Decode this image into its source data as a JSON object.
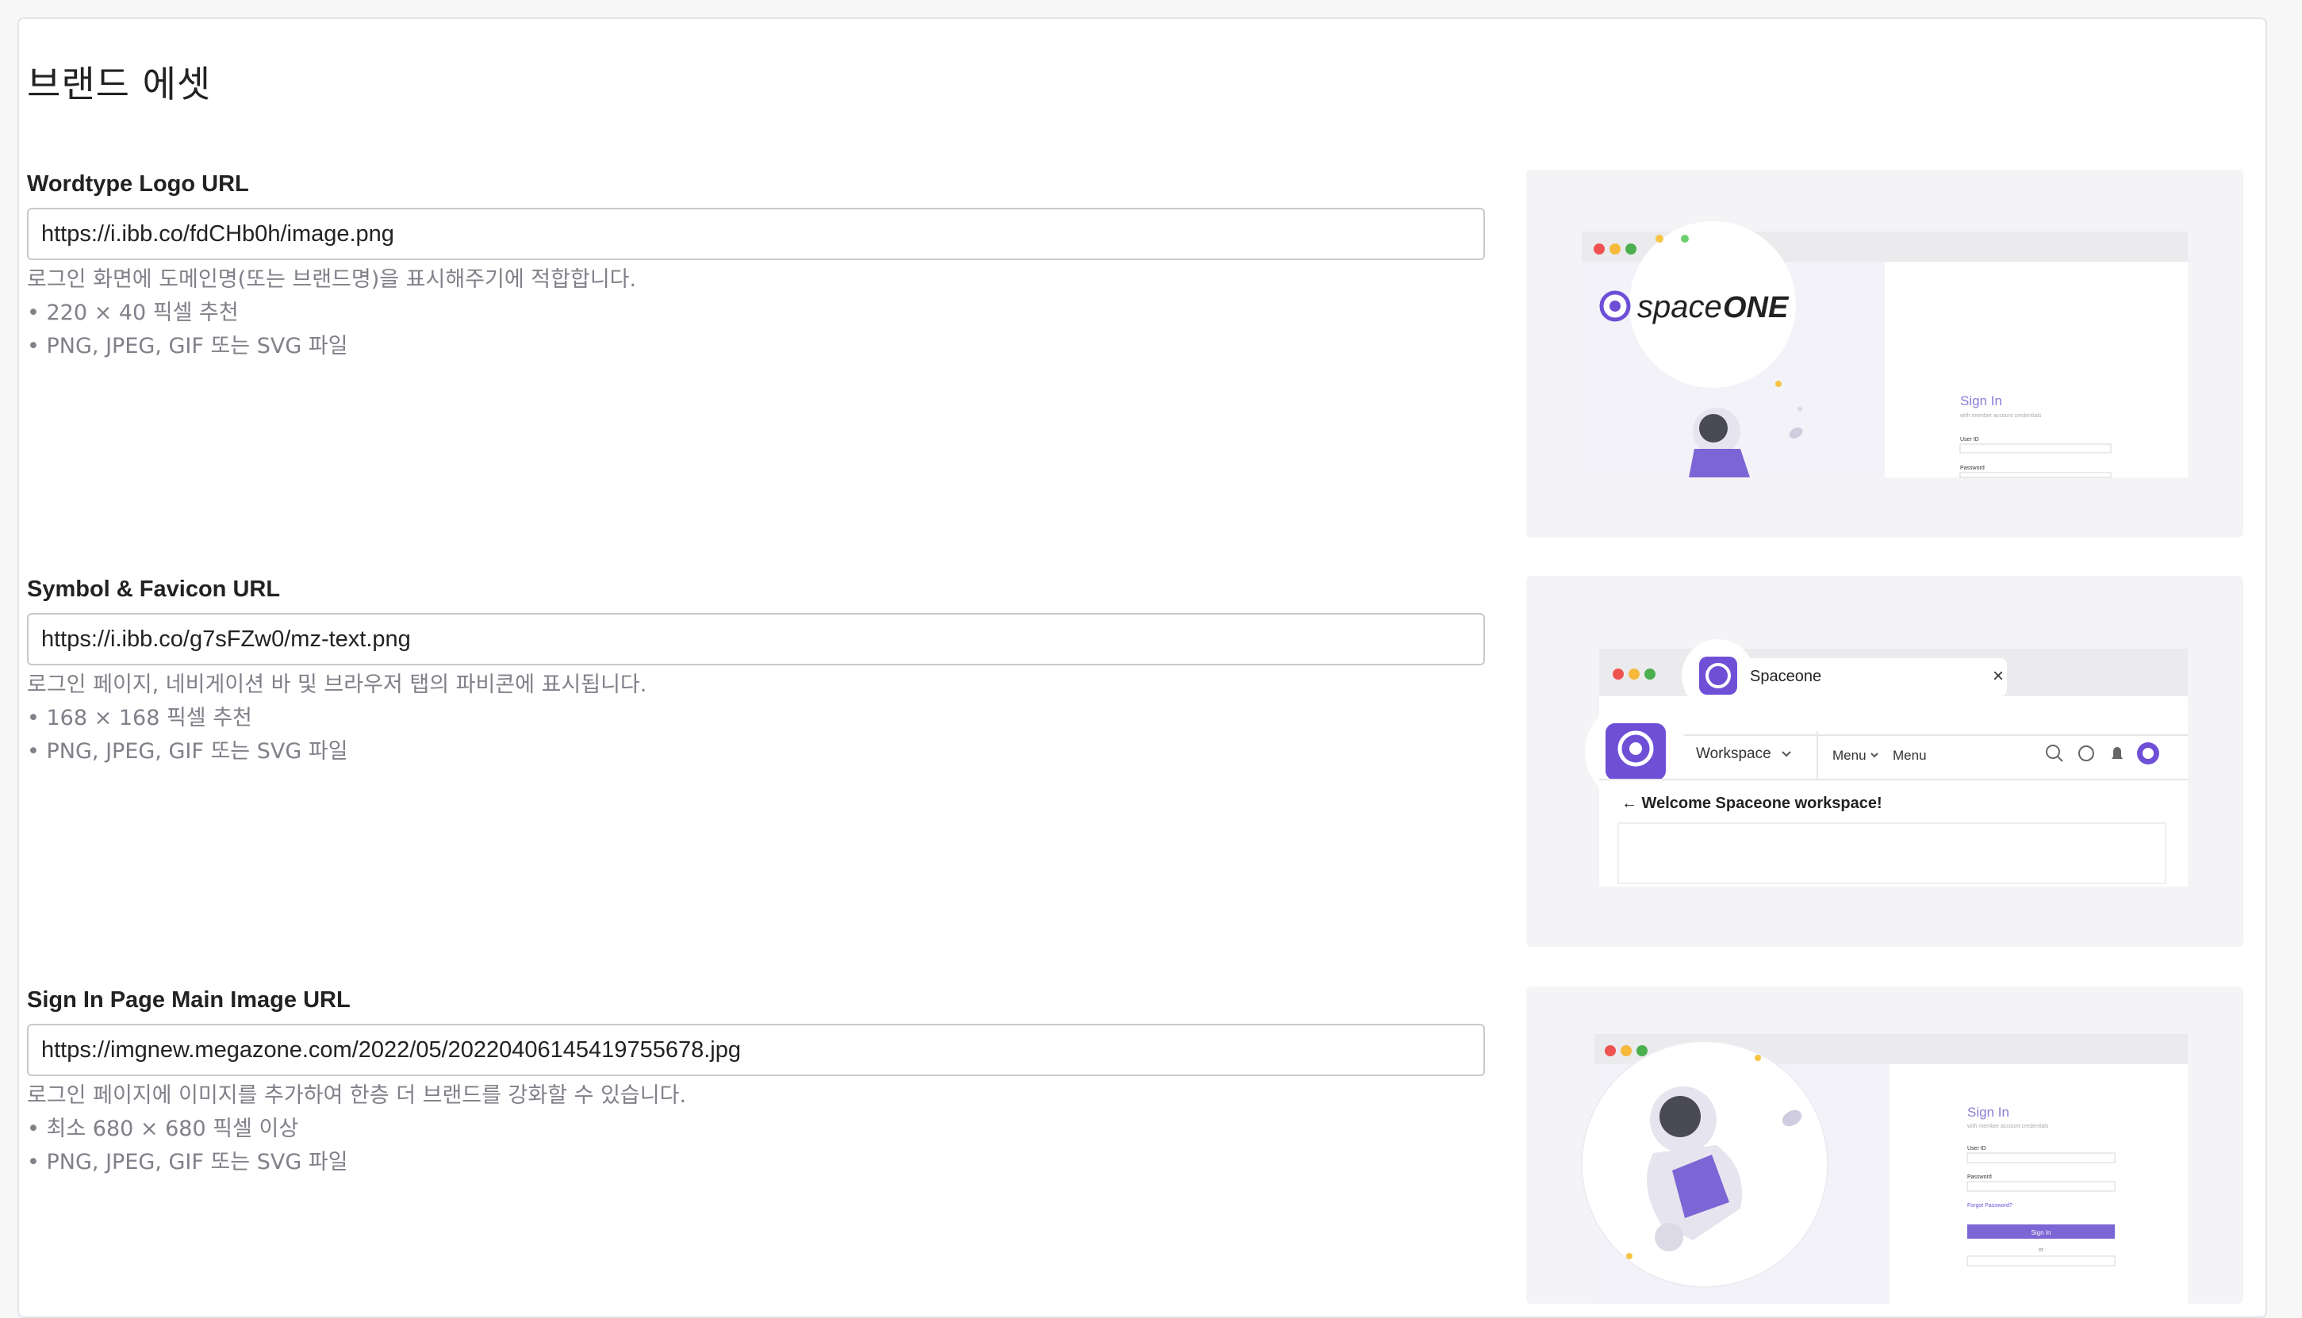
{
  "page": {
    "title": "브랜드 에셋"
  },
  "sections": [
    {
      "label": "Wordtype Logo URL",
      "value": "https://i.ibb.co/fdCHb0h/image.png",
      "help": [
        "로그인 화면에 도메인명(또는 브랜드명)을 표시해주기에 적합합니다.",
        "• 220 × 40 픽셀 추천",
        "• PNG, JPEG, GIF 또는 SVG 파일"
      ]
    },
    {
      "label": "Symbol & Favicon URL",
      "value": "https://i.ibb.co/g7sFZw0/mz-text.png",
      "help": [
        "로그인 페이지, 네비게이션 바 및 브라우저 탭의 파비콘에 표시됩니다.",
        "• 168 × 168 픽셀 추천",
        "• PNG, JPEG, GIF 또는 SVG 파일"
      ]
    },
    {
      "label": "Sign In Page Main Image URL",
      "value": "https://imgnew.megazone.com/2022/05/20220406145419755678.jpg",
      "help": [
        "로그인 페이지에 이미지를 추가하여 한층 더 브랜드를 강화할 수 있습니다.",
        "• 최소 680 × 680 픽셀 이상",
        "• PNG, JPEG, GIF 또는 SVG 파일"
      ]
    }
  ],
  "previews": {
    "wordtype": {
      "logo_text_a": "space",
      "logo_text_b": "ONE",
      "signin_title": "Sign In",
      "signin_sub": "with member account credentials",
      "user_id_label": "User ID",
      "password_label": "Password"
    },
    "favicon": {
      "tab_title": "Spaceone",
      "tab_close": "×",
      "workspace": "Workspace",
      "menu1": "Menu",
      "menu2": "Menu",
      "welcome": "← Welcome Spaceone workspace!"
    },
    "signin": {
      "signin_title": "Sign In",
      "signin_sub": "with member account credentials",
      "user_id_label": "User ID",
      "password_label": "Password",
      "forgot": "Forgot Password?",
      "button": "Sign In",
      "or": "or"
    }
  },
  "colors": {
    "accent": "#6e4fd6",
    "accent_dark": "#5b3fbf",
    "traffic_red": "#ef5350",
    "traffic_yellow": "#f6b93b",
    "traffic_green": "#4caf50"
  }
}
